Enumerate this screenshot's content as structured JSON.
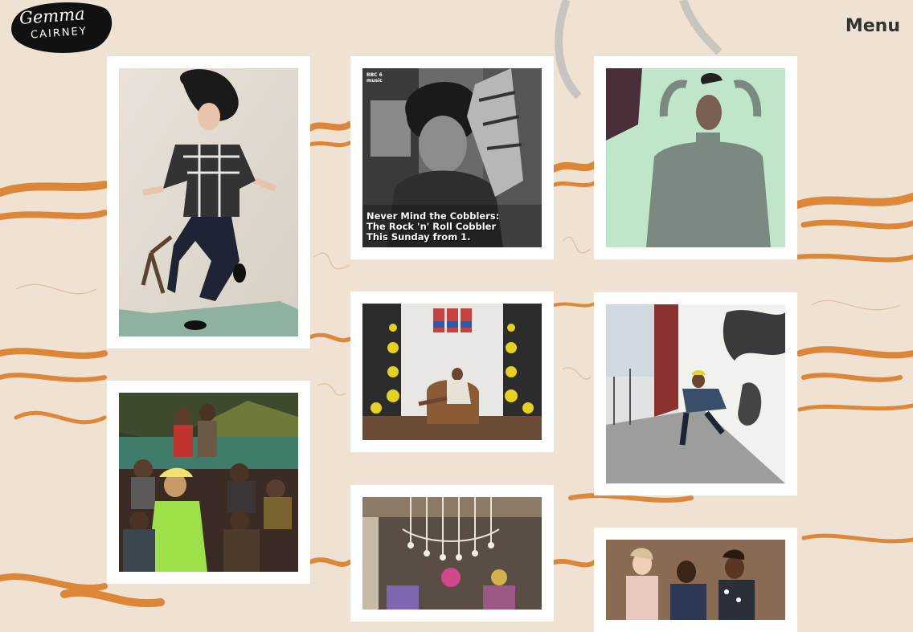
{
  "logo": {
    "line1": "Gemma",
    "line2": "CAIRNEY"
  },
  "nav": {
    "menu_label": "Menu"
  },
  "photos": {
    "p2": {
      "caption_line1": "Never Mind the Cobblers:",
      "caption_line2": "The Rock 'n' Roll Cobbler",
      "caption_line3": "This Sunday from 1.",
      "badge": "BBC 6 music"
    }
  }
}
